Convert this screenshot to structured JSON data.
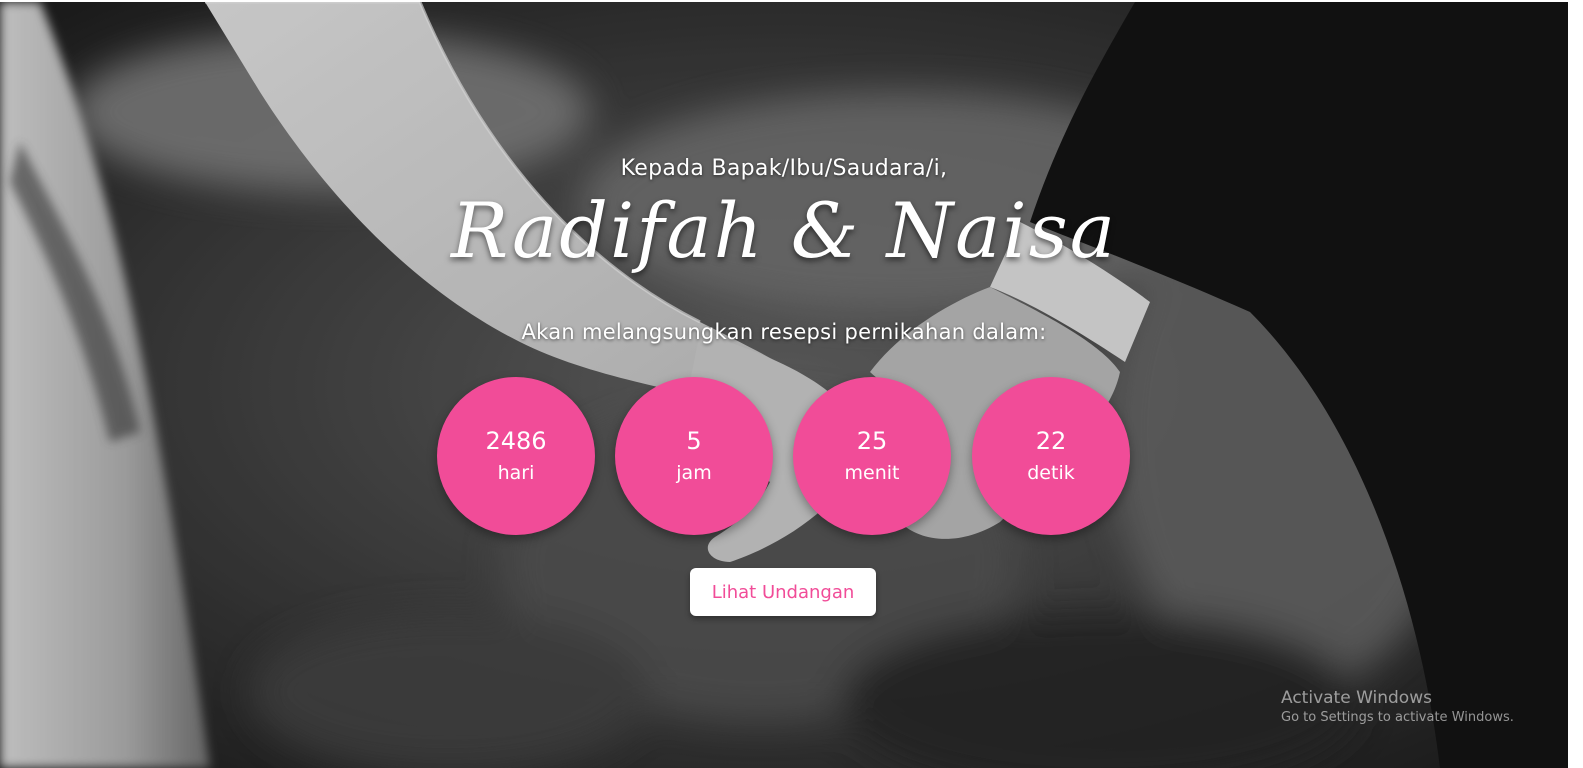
{
  "invitation": {
    "greeting": "Kepada Bapak/Ibu/Saudara/i,",
    "couple_names": "Radifah & Naisa",
    "subtitle": "Akan melangsungkan resepsi pernikahan dalam:"
  },
  "countdown": [
    {
      "value": "2486",
      "unit": "hari"
    },
    {
      "value": "5",
      "unit": "jam"
    },
    {
      "value": "25",
      "unit": "menit"
    },
    {
      "value": "22",
      "unit": "detik"
    }
  ],
  "cta": {
    "label": "Lihat Undangan"
  },
  "os_watermark": {
    "title": "Activate Windows",
    "subtitle": "Go to Settings to activate Windows."
  },
  "colors": {
    "accent": "#f14c98",
    "button_bg": "#ffffff",
    "text": "#ffffff"
  },
  "background": {
    "icon": "couple-holding-hands-photo",
    "style": "black-and-white"
  }
}
